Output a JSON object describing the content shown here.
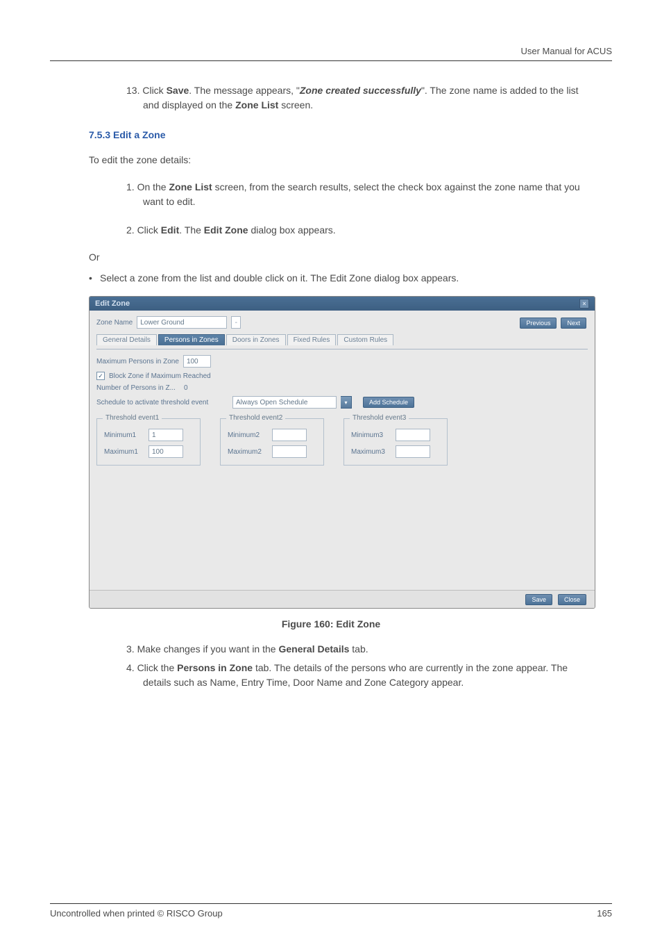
{
  "header": {
    "doc_title": "User Manual for ACUS"
  },
  "step13": {
    "pre": "13.  Click ",
    "b1": "Save",
    "mid1": ". The message appears, \"",
    "bi": "Zone created successfully",
    "mid2": "\". The zone name is added to the list and displayed on the ",
    "b2": "Zone List",
    "post": " screen."
  },
  "section": {
    "title": "7.5.3  Edit a Zone"
  },
  "intro": "To edit the zone details:",
  "step1": {
    "pre": "1.   On the ",
    "b1": "Zone List",
    "post": " screen, from the search results, select the check box against the zone name that you want to edit."
  },
  "step2": {
    "pre": "2.   Click ",
    "b1": "Edit",
    "mid": ". The ",
    "b2": "Edit Zone",
    "post": " dialog box appears."
  },
  "or": "Or",
  "bullet": "Select a zone from the list and double click on it. The Edit Zone dialog box appears.",
  "shot": {
    "title": "Edit Zone",
    "close": "×",
    "zoneNameLabel": "Zone Name",
    "zoneName": "Lower Ground",
    "prevBtn": "Previous",
    "nextBtn": "Next",
    "tabs": {
      "general": "General Details",
      "persons": "Persons in Zones",
      "doors": "Doors in Zones",
      "fixed": "Fixed Rules",
      "custom": "Custom Rules"
    },
    "maxPersonsLabel": "Maximum Persons in Zone",
    "maxPersons": "100",
    "blockLabel": "Block Zone if Maximum Reached",
    "numPersonsLabel": "Number of Persons in Z...",
    "numPersons": "0",
    "scheduleLabel": "Schedule to activate threshold event",
    "scheduleValue": "Always Open Schedule",
    "addScheduleBtn": "Add Schedule",
    "th1": {
      "legend": "Threshold event1",
      "minLbl": "Minimum1",
      "min": "1",
      "maxLbl": "Maximum1",
      "max": "100"
    },
    "th2": {
      "legend": "Threshold event2",
      "minLbl": "Minimum2",
      "min": "",
      "maxLbl": "Maximum2",
      "max": ""
    },
    "th3": {
      "legend": "Threshold event3",
      "minLbl": "Minimum3",
      "min": "",
      "maxLbl": "Maximum3",
      "max": ""
    },
    "saveBtn": "Save",
    "closeBtn": "Close"
  },
  "figcaption": "Figure 160: Edit Zone",
  "step3": {
    "pre": "3.   Make changes if you want in the ",
    "b1": "General Details",
    "post": " tab."
  },
  "step4": {
    "pre": "4.   Click the ",
    "b1": "Persons in Zone",
    "post": " tab. The details of the persons who are currently in the zone appear. The details such as Name, Entry Time, Door Name and Zone Category appear."
  },
  "footer": {
    "left": "Uncontrolled when printed © RISCO Group",
    "right": "165"
  }
}
